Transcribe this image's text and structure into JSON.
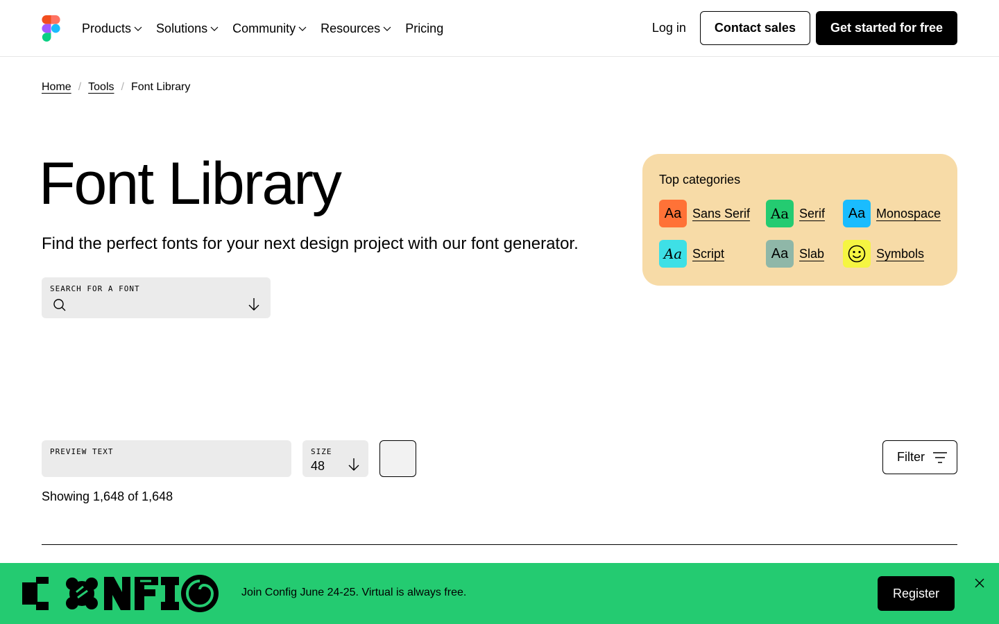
{
  "nav": {
    "links": [
      {
        "label": "Products",
        "has_dropdown": true
      },
      {
        "label": "Solutions",
        "has_dropdown": true
      },
      {
        "label": "Community",
        "has_dropdown": true
      },
      {
        "label": "Resources",
        "has_dropdown": true
      },
      {
        "label": "Pricing",
        "has_dropdown": false
      }
    ],
    "login": "Log in",
    "contact_sales": "Contact sales",
    "get_started": "Get started for free"
  },
  "breadcrumb": {
    "items": [
      "Home",
      "Tools",
      "Font Library"
    ],
    "separator": "/"
  },
  "hero": {
    "title": "Font Library",
    "subtitle": "Find the perfect fonts for your next design project with our font generator.",
    "search_label": "SEARCH FOR A FONT"
  },
  "categories": {
    "title": "Top categories",
    "items": [
      {
        "label": "Sans Serif",
        "badge": "Aa",
        "color": "#ff7237"
      },
      {
        "label": "Serif",
        "badge": "Aa",
        "color": "#24cb71"
      },
      {
        "label": "Monospace",
        "badge": "Aa",
        "color": "#0acf83"
      },
      {
        "label": "Script",
        "badge": "Aa",
        "color": "#3ee0e6"
      },
      {
        "label": "Slab",
        "badge": "Aa",
        "color": "#8fb7a8"
      },
      {
        "label": "Symbols",
        "badge": "smiley",
        "color": "#f5f542"
      }
    ]
  },
  "controls": {
    "preview_label": "PREVIEW TEXT",
    "size_label": "SIZE",
    "size_value": "48",
    "filter_label": "Filter",
    "showing": "Showing 1,648 of 1,648"
  },
  "banner": {
    "text": "Join Config June 24-25. Virtual is always free.",
    "register": "Register",
    "bg_color": "#24cb71"
  },
  "icons": [
    "figma-logo-icon",
    "chevron-down-icon",
    "search-icon",
    "arrow-down-icon",
    "filter-icon",
    "close-icon",
    "config-logo"
  ]
}
